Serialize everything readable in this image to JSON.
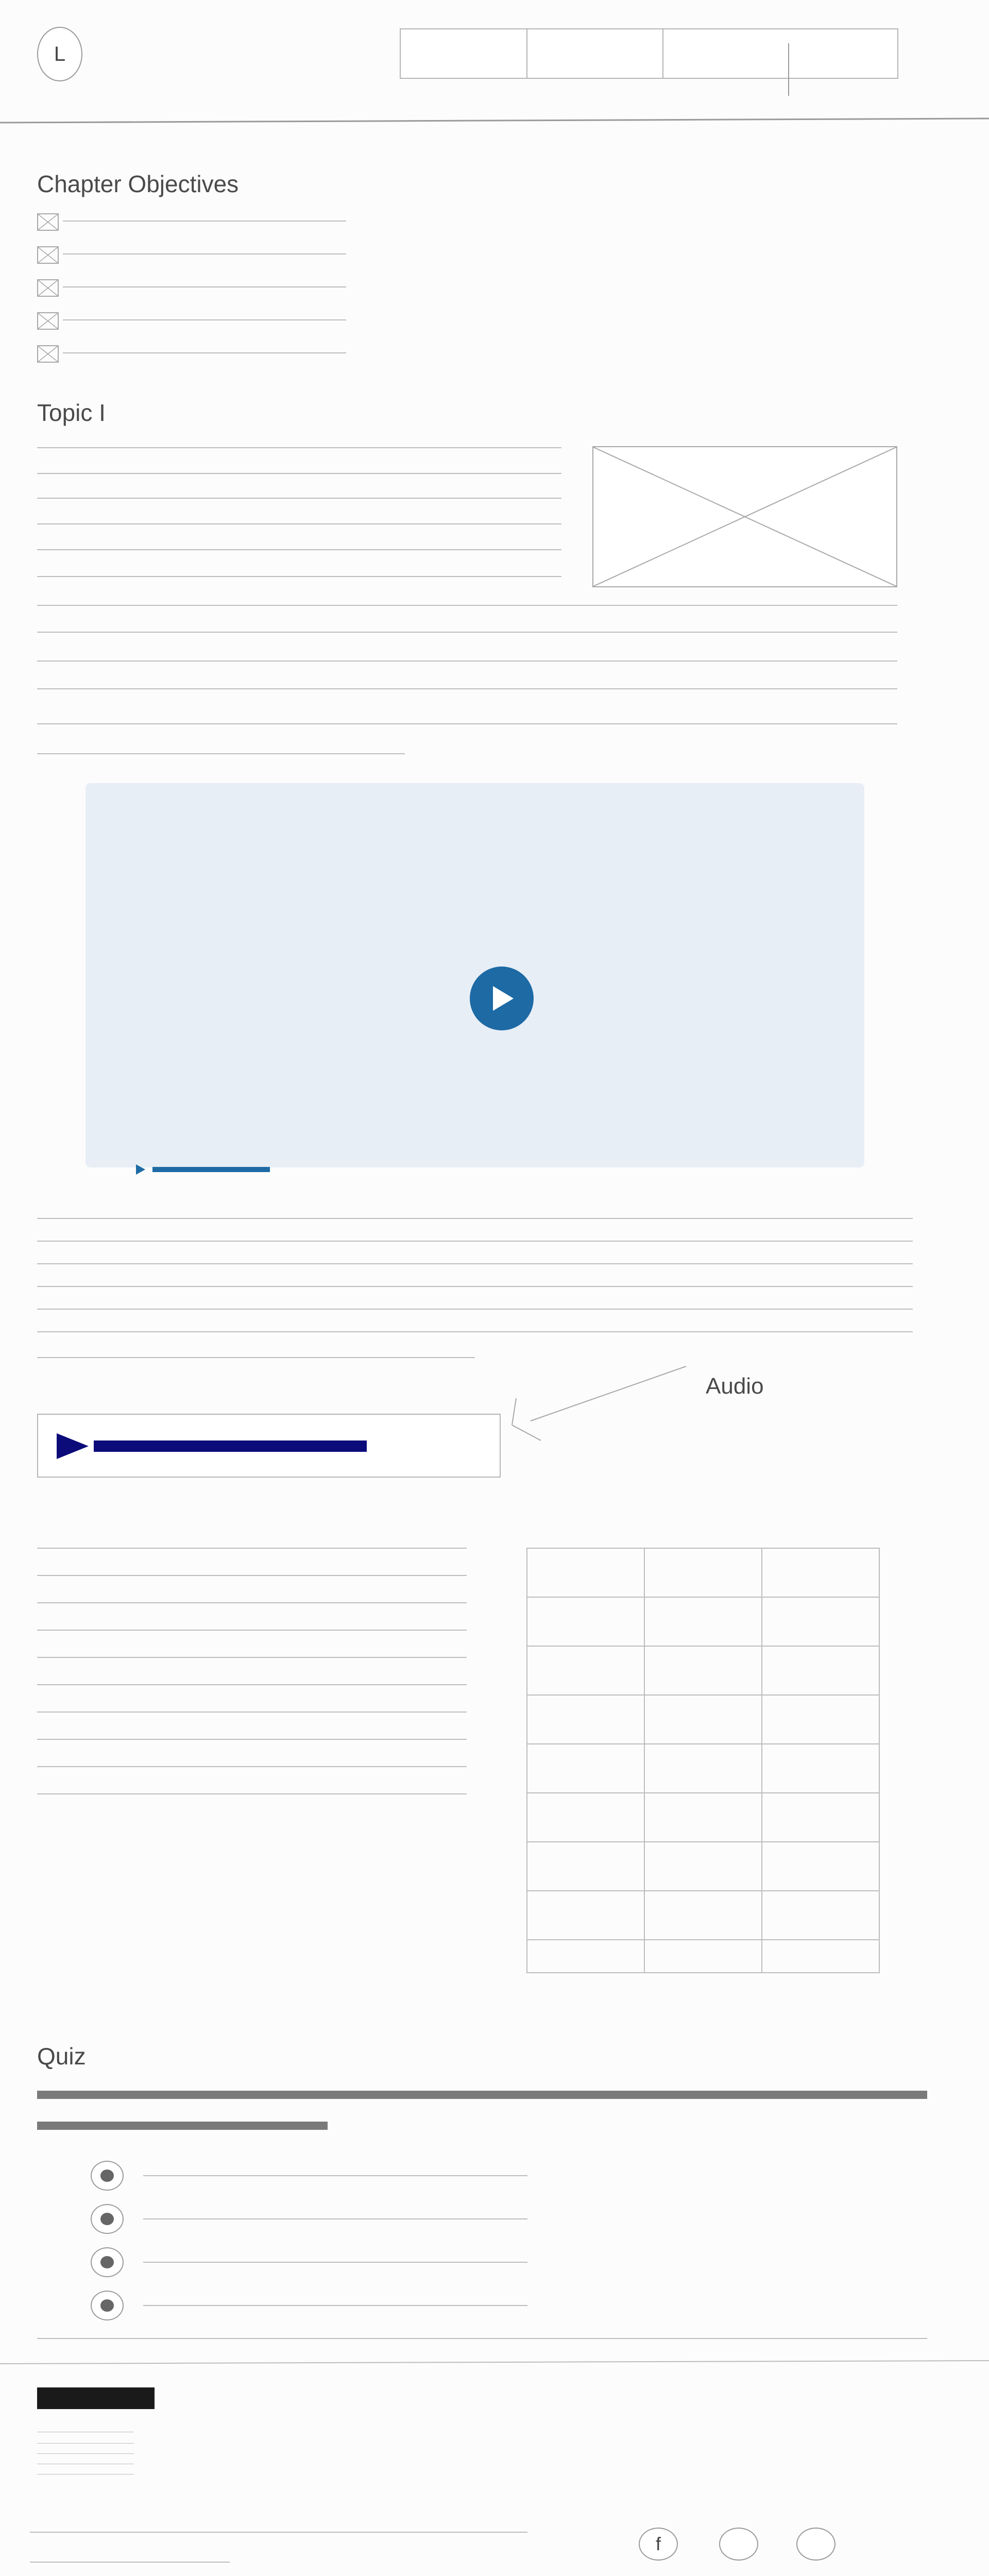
{
  "header": {
    "logo_letter": "L",
    "nav": [
      "",
      "",
      ""
    ]
  },
  "objectives": {
    "title": "Chapter Objectives",
    "items": 5
  },
  "topic": {
    "title": "Topic I"
  },
  "video": {
    "progress": 0.15,
    "accent": "#1d6aa5"
  },
  "audio": {
    "label": "Audio",
    "accent": "#0b0b7a"
  },
  "quiz": {
    "title": "Quiz",
    "options": 4
  },
  "footer": {
    "social": [
      {
        "icon": "facebook-icon",
        "label": "f"
      },
      {
        "icon": "social-icon-2",
        "label": ""
      },
      {
        "icon": "social-icon-3",
        "label": ""
      }
    ]
  }
}
